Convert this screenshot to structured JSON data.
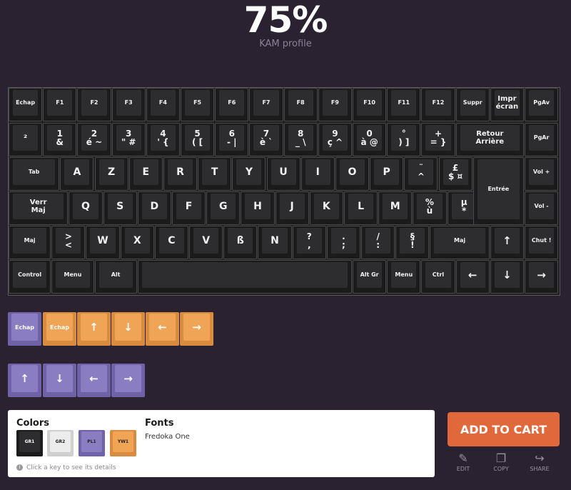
{
  "header": {
    "title": "75%",
    "subtitle": "KAM profile"
  },
  "keys": {
    "row1": [
      "Echap",
      "F1",
      "F2",
      "F3",
      "F4",
      "F5",
      "F6",
      "F7",
      "F8",
      "F9",
      "F10",
      "F11",
      "F12",
      "Suppr"
    ],
    "impr": [
      "Impr",
      "écran"
    ],
    "pgav": "PgAv",
    "row2": [
      {
        "t": "",
        "b": "²"
      },
      {
        "t": "1",
        "b": "&"
      },
      {
        "t": "2",
        "b": "é ~"
      },
      {
        "t": "3",
        "b": "\" #"
      },
      {
        "t": "4",
        "b": "' {"
      },
      {
        "t": "5",
        "b": "( ["
      },
      {
        "t": "6",
        "b": "- |"
      },
      {
        "t": "7",
        "b": "è `"
      },
      {
        "t": "8",
        "b": "_ \\"
      },
      {
        "t": "9",
        "b": "ç ^"
      },
      {
        "t": "0",
        "b": "à @"
      },
      {
        "t": "°",
        "b": ") ]"
      },
      {
        "t": "+",
        "b": "= }"
      }
    ],
    "backspace": [
      "Retour",
      "Arrière"
    ],
    "pgar": "PgAr",
    "tab": "Tab",
    "row3": [
      "A",
      "Z",
      "E",
      "R",
      "T",
      "Y",
      "U",
      "I",
      "O",
      "P"
    ],
    "row3b": [
      {
        "t": "¨",
        "b": "^"
      },
      {
        "t": "£",
        "b": "$ ¤"
      }
    ],
    "vol_up": "Vol +",
    "capslock": [
      "Verr",
      "Maj"
    ],
    "row4": [
      "Q",
      "S",
      "D",
      "F",
      "G",
      "H",
      "J",
      "K",
      "L",
      "M"
    ],
    "row4b": [
      {
        "t": "%",
        "b": "ù"
      },
      {
        "t": "µ",
        "b": "*"
      }
    ],
    "enter": "Entrée",
    "vol_down": "Vol -",
    "shift_l": "Maj",
    "iso": {
      "t": ">",
      "b": "<"
    },
    "row5": [
      "W",
      "X",
      "C",
      "V",
      "ß",
      "N"
    ],
    "row5b": [
      {
        "t": "?",
        "b": ","
      },
      {
        "t": ".",
        "b": ";"
      },
      {
        "t": "/",
        "b": ":"
      },
      {
        "t": "§",
        "b": "!"
      }
    ],
    "shift_r": "Maj",
    "mute": "Chut !",
    "control": "Control",
    "menu_l": "Menu",
    "alt": "Alt",
    "altgr": "Alt Gr",
    "menu_r": "Menu",
    "ctrl_r": "Ctrl",
    "arrow_up": "↑",
    "arrow_left": "←",
    "arrow_down": "↓",
    "arrow_right": "→"
  },
  "extras1": {
    "echap_purple": "Echap",
    "echap_orange": "Echap",
    "up": "↑",
    "down": "↓",
    "left": "←",
    "right": "→"
  },
  "extras2": {
    "up": "↑",
    "down": "↓",
    "left": "←",
    "right": "→"
  },
  "details": {
    "colors_title": "Colors",
    "swatches": [
      "GR1",
      "GR2",
      "PL1",
      "YW1"
    ],
    "swatch_colors": [
      "#2a2a2a",
      "#ececec",
      "#8b7dc2",
      "#f0a455"
    ],
    "fonts_title": "Fonts",
    "font_name": "Fredoka One",
    "hint": "Click a key to see its details"
  },
  "actions": {
    "add_to_cart": "ADD TO CART",
    "edit": "EDIT",
    "copy": "COPY",
    "share": "SHARE"
  }
}
